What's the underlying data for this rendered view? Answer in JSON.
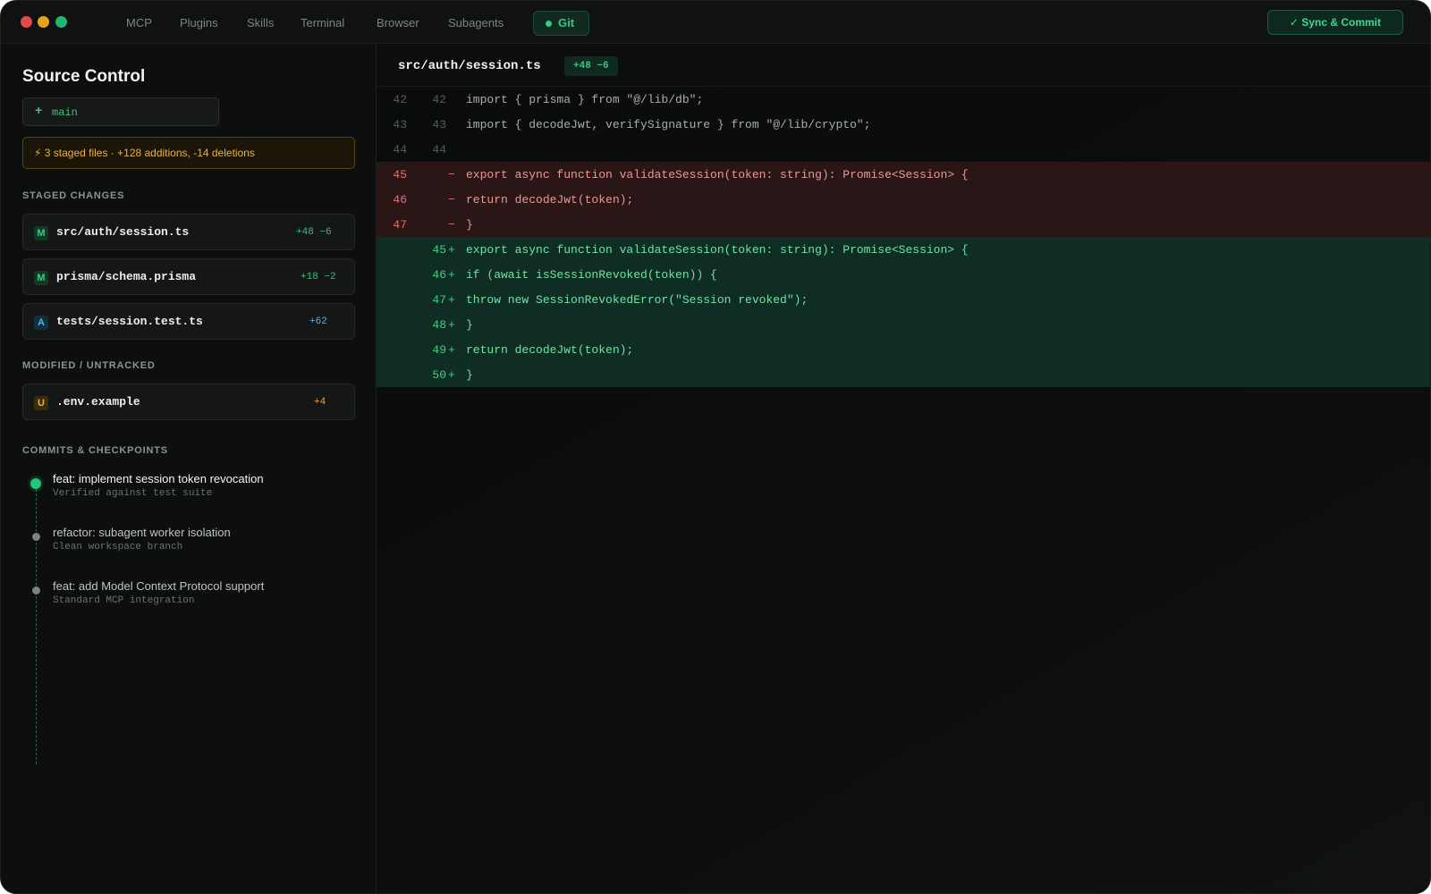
{
  "nav": {
    "tabs": [
      {
        "label": "MCP"
      },
      {
        "label": "Plugins"
      },
      {
        "label": "Skills"
      },
      {
        "label": "Terminal"
      },
      {
        "label": "Browser"
      },
      {
        "label": "Subagents"
      },
      {
        "label": "Git",
        "active": true
      }
    ],
    "sync_label": "✓ Sync & Commit"
  },
  "sidebar": {
    "title": "Source Control",
    "branch": {
      "icon": "+",
      "name": "main"
    },
    "staged_banner": "⚡ 3 staged files · +128 additions, -14 deletions",
    "staged_label": "STAGED CHANGES",
    "staged_files": [
      {
        "badge": "M",
        "path": "src/auth/session.ts",
        "stat": "+48 −6"
      },
      {
        "badge": "M",
        "path": "prisma/schema.prisma",
        "stat": "+18 −2"
      },
      {
        "badge": "A",
        "path": "tests/session.test.ts",
        "stat": "+62"
      }
    ],
    "modified_label": "MODIFIED / UNTRACKED",
    "modified_files": [
      {
        "badge": "U",
        "path": ".env.example",
        "stat": "+4"
      }
    ],
    "commits_label": "COMMITS & CHECKPOINTS",
    "commits": [
      {
        "title": "feat: implement session token revocation",
        "subtitle": "Verified against test suite"
      },
      {
        "title": "refactor: subagent worker isolation",
        "subtitle": "Clean workspace branch"
      },
      {
        "title": "feat: add Model Context Protocol support",
        "subtitle": "Standard MCP integration"
      }
    ]
  },
  "editor": {
    "file": "src/auth/session.ts",
    "stat": "+48 −6",
    "lines": [
      {
        "type": "ctx",
        "old": "42",
        "new": "42",
        "sign": "",
        "code": "import { prisma } from \"@/lib/db\";"
      },
      {
        "type": "ctx",
        "old": "43",
        "new": "43",
        "sign": "",
        "code": "import { decodeJwt, verifySignature } from \"@/lib/crypto\";"
      },
      {
        "type": "ctx",
        "old": "44",
        "new": "44",
        "sign": "",
        "code": ""
      },
      {
        "type": "del",
        "old": "45",
        "new": "",
        "sign": "−",
        "code": "export async function validateSession(token: string): Promise<Session> {"
      },
      {
        "type": "del",
        "old": "46",
        "new": "",
        "sign": "−",
        "code": "return decodeJwt(token);"
      },
      {
        "type": "del",
        "old": "47",
        "new": "",
        "sign": "−",
        "code": "}"
      },
      {
        "type": "add",
        "old": "",
        "new": "45",
        "sign": "+",
        "code": "export async function validateSession(token: string): Promise<Session> {"
      },
      {
        "type": "add",
        "old": "",
        "new": "46",
        "sign": "+",
        "code": "if (await isSessionRevoked(token)) {"
      },
      {
        "type": "add",
        "old": "",
        "new": "47",
        "sign": "+",
        "code": "throw new SessionRevokedError(\"Session revoked\");"
      },
      {
        "type": "add",
        "old": "",
        "new": "48",
        "sign": "+",
        "code": "}"
      },
      {
        "type": "add",
        "old": "",
        "new": "49",
        "sign": "+",
        "code": "return decodeJwt(token);"
      },
      {
        "type": "add",
        "old": "",
        "new": "50",
        "sign": "+",
        "code": "}"
      }
    ]
  },
  "colors": {
    "accent": "#22c57a",
    "deletion_bg": "#2a1616",
    "addition_bg": "#0f2d22",
    "warning": "#e8b33a"
  }
}
